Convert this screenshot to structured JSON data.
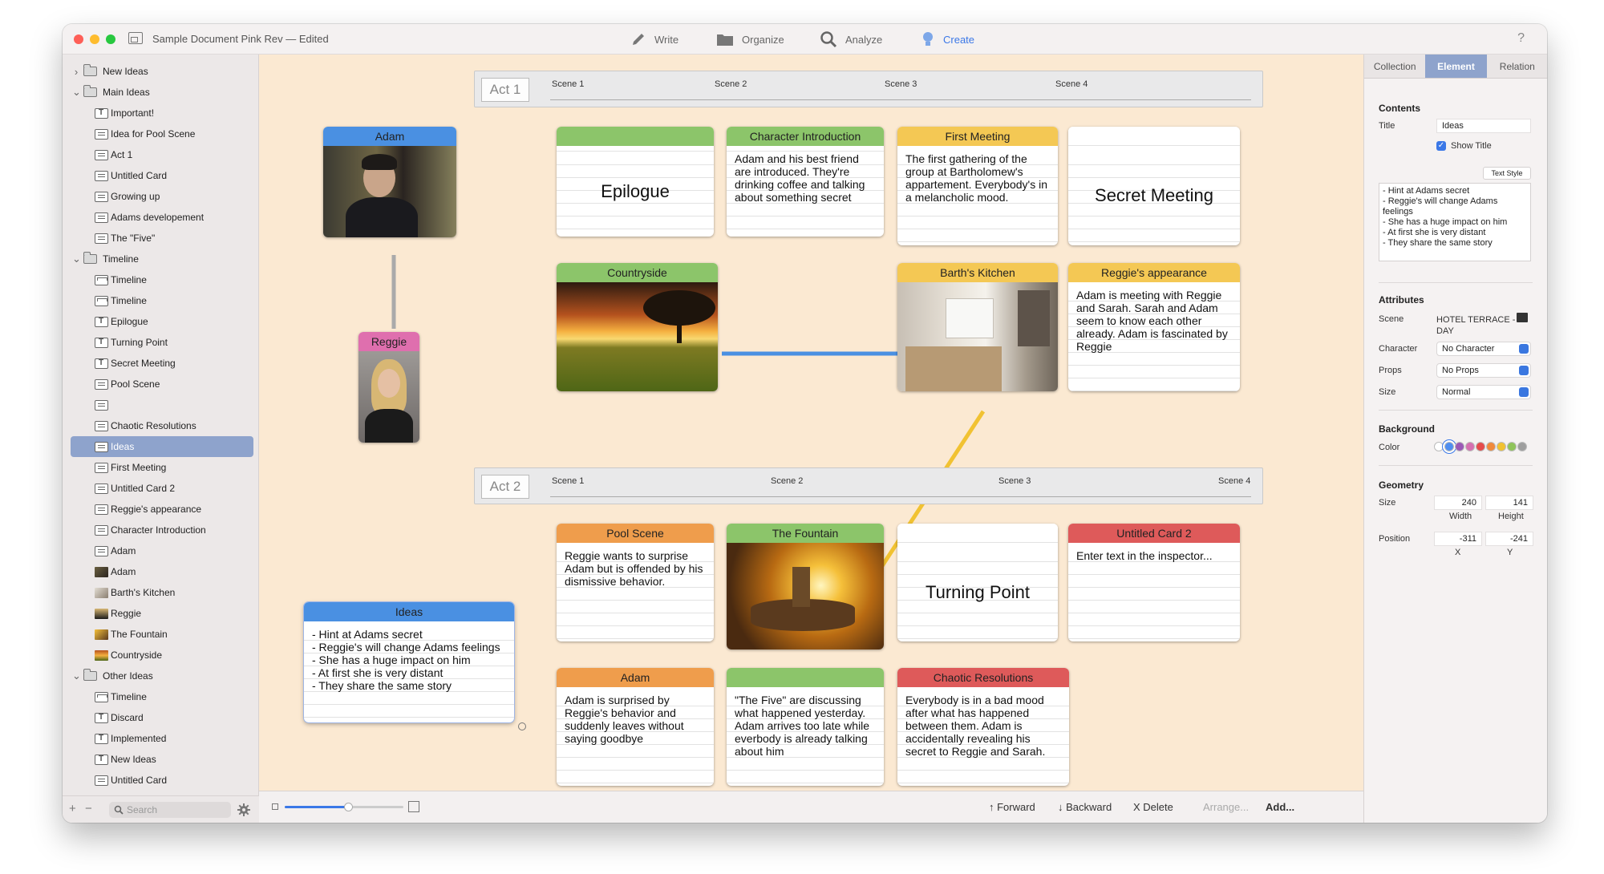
{
  "window": {
    "title": "Sample Document Pink Rev",
    "edited": "— Edited"
  },
  "toolbar": {
    "write": "Write",
    "organize": "Organize",
    "analyze": "Analyze",
    "create": "Create",
    "help": "?"
  },
  "sidebar": {
    "items": [
      {
        "label": "New Ideas",
        "icon": "folder",
        "depth": 0,
        "chev": ">"
      },
      {
        "label": "Main Ideas",
        "icon": "folder",
        "depth": 0,
        "chev": "v"
      },
      {
        "label": "Important!",
        "icon": "text",
        "depth": 1
      },
      {
        "label": "Idea for Pool Scene",
        "icon": "doc",
        "depth": 1
      },
      {
        "label": "Act 1",
        "icon": "doc",
        "depth": 1
      },
      {
        "label": "Untitled Card",
        "icon": "doc",
        "depth": 1
      },
      {
        "label": "Growing up",
        "icon": "doc",
        "depth": 1
      },
      {
        "label": "Adams developement",
        "icon": "doc",
        "depth": 1
      },
      {
        "label": "The \"Five\"",
        "icon": "doc",
        "depth": 1
      },
      {
        "label": "Timeline",
        "icon": "folder",
        "depth": 0,
        "chev": "v"
      },
      {
        "label": "Timeline",
        "icon": "timeline",
        "depth": 1
      },
      {
        "label": "Timeline",
        "icon": "timeline",
        "depth": 1
      },
      {
        "label": "Epilogue",
        "icon": "text",
        "depth": 1
      },
      {
        "label": "Turning Point",
        "icon": "text",
        "depth": 1
      },
      {
        "label": "Secret Meeting",
        "icon": "text",
        "depth": 1
      },
      {
        "label": "Pool Scene",
        "icon": "doc",
        "depth": 1
      },
      {
        "label": "",
        "icon": "doc",
        "depth": 1
      },
      {
        "label": "Chaotic Resolutions",
        "icon": "doc",
        "depth": 1
      },
      {
        "label": "Ideas",
        "icon": "doc",
        "depth": 1,
        "selected": true
      },
      {
        "label": "First Meeting",
        "icon": "doc",
        "depth": 1
      },
      {
        "label": "Untitled Card 2",
        "icon": "doc",
        "depth": 1
      },
      {
        "label": "Reggie's appearance",
        "icon": "doc",
        "depth": 1
      },
      {
        "label": "Character Introduction",
        "icon": "doc",
        "depth": 1
      },
      {
        "label": "Adam",
        "icon": "doc",
        "depth": 1
      },
      {
        "label": "Adam",
        "icon": "thumb-adam",
        "depth": 1
      },
      {
        "label": "Barth's Kitchen",
        "icon": "thumb-kitchen",
        "depth": 1
      },
      {
        "label": "Reggie",
        "icon": "thumb-reggie",
        "depth": 1
      },
      {
        "label": "The Fountain",
        "icon": "thumb-fountain",
        "depth": 1
      },
      {
        "label": "Countryside",
        "icon": "thumb-country",
        "depth": 1
      },
      {
        "label": "Other Ideas",
        "icon": "folder",
        "depth": 0,
        "chev": "v"
      },
      {
        "label": "Timeline",
        "icon": "timeline",
        "depth": 1
      },
      {
        "label": "Discard",
        "icon": "text",
        "depth": 1
      },
      {
        "label": "Implemented",
        "icon": "text",
        "depth": 1
      },
      {
        "label": "New Ideas",
        "icon": "text",
        "depth": 1
      },
      {
        "label": "Untitled Card",
        "icon": "doc",
        "depth": 1
      }
    ],
    "search_placeholder": "Search",
    "add": "+",
    "remove": "−"
  },
  "acts": [
    {
      "label": "Act 1",
      "scenes": [
        "Scene 1",
        "Scene 2",
        "Scene 3",
        "Scene 4"
      ]
    },
    {
      "label": "Act 2",
      "scenes": [
        "Scene 1",
        "Scene 2",
        "Scene 3",
        "Scene 4"
      ]
    }
  ],
  "cards": {
    "adam": {
      "title": "Adam"
    },
    "reggie": {
      "title": "Reggie"
    },
    "epilogue": {
      "title": "",
      "big": "Epilogue"
    },
    "char_intro": {
      "title": "Character Introduction",
      "body": "Adam and his best friend are introduced. They're drinking coffee and talking about something secret"
    },
    "first_meeting": {
      "title": "First Meeting",
      "body": "The first gathering of the group at Bartholomew's appartement. Everybody's in a melancholic mood."
    },
    "secret_meeting": {
      "title": "",
      "big": "Secret Meeting"
    },
    "countryside": {
      "title": "Countryside"
    },
    "kitchen": {
      "title": "Barth's Kitchen"
    },
    "reggie_app": {
      "title": "Reggie's appearance",
      "body": "Adam is meeting with Reggie and Sarah. Sarah and Adam seem to know each other already. Adam is fascinated by Reggie"
    },
    "pool": {
      "title": "Pool Scene",
      "body": "Reggie wants to surprise Adam but is offended by his dismissive behavior."
    },
    "fountain": {
      "title": "The Fountain"
    },
    "turning": {
      "title": "",
      "big": "Turning Point"
    },
    "untitled2": {
      "title": "Untitled Card 2",
      "body": "Enter text in the inspector..."
    },
    "ideas": {
      "title": "Ideas",
      "body": "- Hint at Adams secret\n- Reggie's will change Adams feelings\n- She has a huge impact on him\n- At first she is very distant\n- They share the same story"
    },
    "adam2": {
      "title": "Adam",
      "body": "Adam is surprised by Reggie's behavior and suddenly leaves without saying goodbye"
    },
    "five": {
      "title": "",
      "body": "\"The Five\" are discussing what happened yesterday. Adam arrives too late while everbody is already talking about him"
    },
    "chaotic": {
      "title": "Chaotic Resolutions",
      "body": "Everybody is in a bad mood after what has happened between them. Adam is accidentally revealing his secret to Reggie and Sarah."
    }
  },
  "bottom": {
    "forward": "↑ Forward",
    "backward": "↓ Backward",
    "delete": "X Delete",
    "arrange": "Arrange...",
    "add": "Add..."
  },
  "inspector": {
    "tabs": [
      "Collection",
      "Element",
      "Relation"
    ],
    "contents": "Contents",
    "title_label": "Title",
    "title_value": "Ideas",
    "show_title": "Show Title",
    "text_style": "Text Style",
    "notes": "- Hint at Adams secret\n- Reggie's will change Adams feelings\n- She has a huge impact on him\n- At first she is very distant\n- They share the same story",
    "attributes": "Attributes",
    "scene_label": "Scene",
    "scene_value": "HOTEL TERRACE - DAY",
    "character_label": "Character",
    "character_value": "No Character",
    "props_label": "Props",
    "props_value": "No Props",
    "size_label": "Size",
    "size_value": "Normal",
    "background": "Background",
    "color_label": "Color",
    "colors": [
      "#ffffff",
      "#4f8ef0",
      "#9b59b6",
      "#d670b0",
      "#e64c4c",
      "#f08a3c",
      "#f1c232",
      "#8fc45a",
      "#9e9e9e"
    ],
    "geometry": "Geometry",
    "geo_size_label": "Size",
    "width": "240",
    "height": "141",
    "width_label": "Width",
    "height_label": "Height",
    "position_label": "Position",
    "x": "-311",
    "y": "-241",
    "x_label": "X",
    "y_label": "Y"
  }
}
